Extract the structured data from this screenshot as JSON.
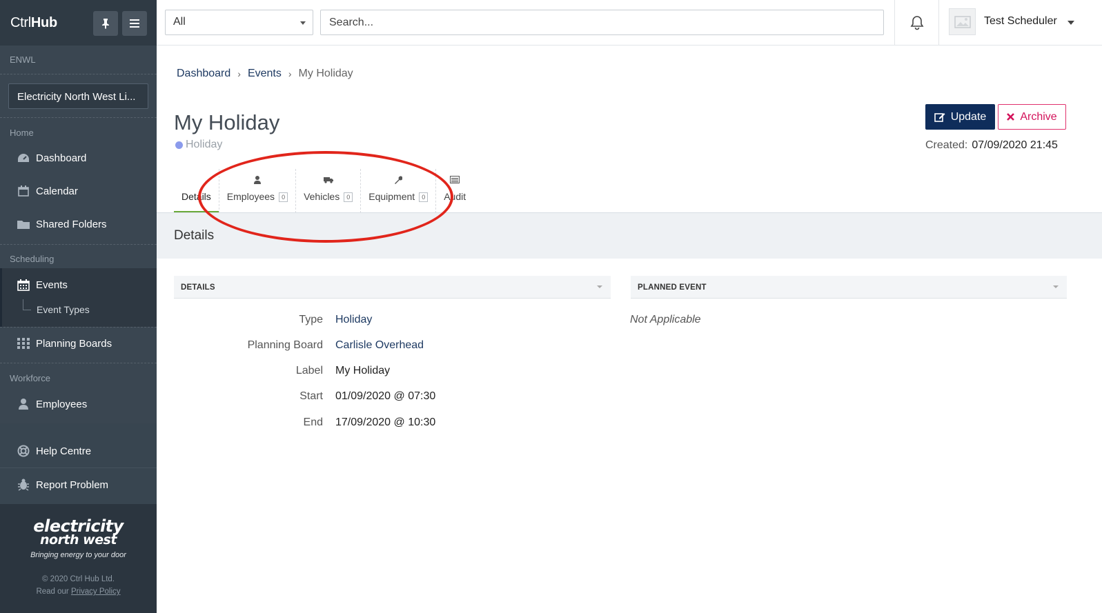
{
  "app": {
    "brand_light": "Ctrl",
    "brand_bold": "Hub"
  },
  "sidebar": {
    "org_section": "ENWL",
    "org_name": "Electricity North West Li...",
    "sections": {
      "home": "Home",
      "scheduling": "Scheduling",
      "workforce": "Workforce"
    },
    "items": {
      "dashboard": "Dashboard",
      "calendar": "Calendar",
      "shared_folders": "Shared Folders",
      "events": "Events",
      "event_types": "Event Types",
      "planning_boards": "Planning Boards",
      "employees": "Employees",
      "help_centre": "Help Centre",
      "report_problem": "Report Problem"
    },
    "footer": {
      "logo_line1": "electricity",
      "logo_line2": "north west",
      "tagline": "Bringing energy to your door",
      "copyright": "© 2020 Ctrl Hub Ltd.",
      "read_our": "Read our",
      "privacy": "Privacy Policy"
    }
  },
  "topbar": {
    "filter_value": "All",
    "search_placeholder": "Search...",
    "user_name": "Test Scheduler"
  },
  "breadcrumb": {
    "dashboard": "Dashboard",
    "events": "Events",
    "current": "My Holiday"
  },
  "page": {
    "title": "My Holiday",
    "type_label": "Holiday",
    "update_label": "Update",
    "archive_label": "Archive",
    "created_label": "Created:",
    "created_value": "07/09/2020 21:45",
    "colors": {
      "accent": "#0f2d5b",
      "archive": "#d3125a",
      "type_dot": "#8b9bec",
      "active_tab": "#6aaa3a",
      "annotation": "#e1251b"
    }
  },
  "tabs": {
    "details": "Details",
    "employees": "Employees",
    "employees_count": "0",
    "vehicles": "Vehicles",
    "vehicles_count": "0",
    "equipment": "Equipment",
    "equipment_count": "0",
    "audit": "Audit"
  },
  "section_title": "Details",
  "details_panel": {
    "header": "DETAILS",
    "rows": [
      {
        "label": "Type",
        "value": "Holiday"
      },
      {
        "label": "Planning Board",
        "value": "Carlisle Overhead"
      },
      {
        "label": "Label",
        "value": "My Holiday"
      },
      {
        "label": "Start",
        "value": "01/09/2020 @ 07:30"
      },
      {
        "label": "End",
        "value": "17/09/2020 @ 10:30"
      }
    ]
  },
  "planned_panel": {
    "header": "PLANNED EVENT",
    "value": "Not Applicable"
  }
}
